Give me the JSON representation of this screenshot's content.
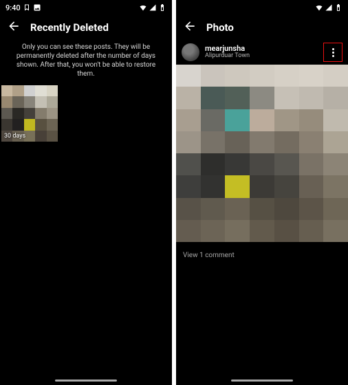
{
  "left": {
    "status_time": "9:40",
    "title": "Recently Deleted",
    "info": "Only you can see these posts. They will be permanently deleted after the number of days shown. After that, you won't be able to restore them.",
    "thumb_days": "30 days"
  },
  "right": {
    "title": "Photo",
    "username": "mearjunsha",
    "location": "Alipurduar Town",
    "comment_text": "View 1 comment"
  }
}
